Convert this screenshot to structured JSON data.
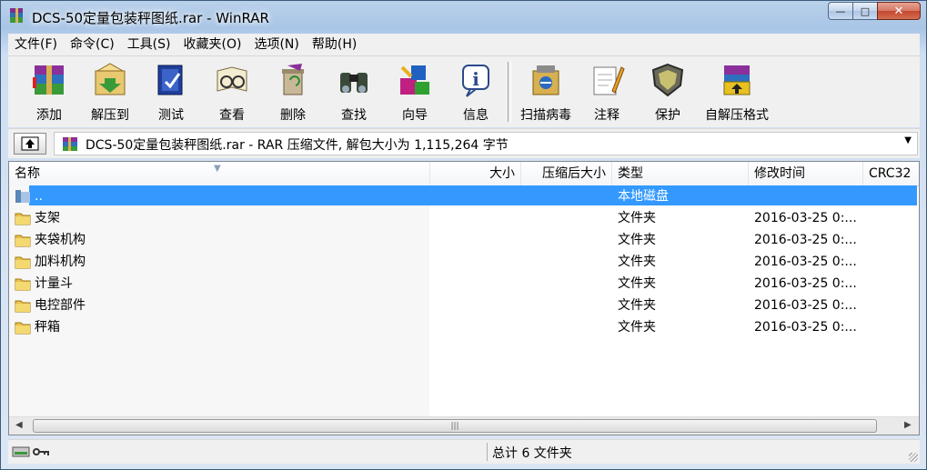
{
  "window": {
    "title": "DCS-50定量包装秤图纸.rar - WinRAR",
    "buttons": {
      "minimize": "—",
      "maximize": "□",
      "close": "✕"
    }
  },
  "menu": [
    "文件(F)",
    "命令(C)",
    "工具(S)",
    "收藏夹(O)",
    "选项(N)",
    "帮助(H)"
  ],
  "toolbar": {
    "items": [
      {
        "label": "添加",
        "icon": "add-archive-icon"
      },
      {
        "label": "解压到",
        "icon": "extract-to-icon"
      },
      {
        "label": "测试",
        "icon": "test-icon"
      },
      {
        "label": "查看",
        "icon": "view-icon"
      },
      {
        "label": "删除",
        "icon": "delete-icon"
      },
      {
        "label": "查找",
        "icon": "find-icon"
      },
      {
        "label": "向导",
        "icon": "wizard-icon"
      },
      {
        "label": "信息",
        "icon": "info-icon"
      },
      {
        "label": "扫描病毒",
        "icon": "virus-scan-icon"
      },
      {
        "label": "注释",
        "icon": "comment-icon"
      },
      {
        "label": "保护",
        "icon": "protect-icon"
      },
      {
        "label": "自解压格式",
        "icon": "sfx-icon"
      }
    ]
  },
  "address": {
    "text": "DCS-50定量包装秤图纸.rar - RAR 压缩文件, 解包大小为 1,115,264 字节"
  },
  "columns": {
    "name": "名称",
    "size": "大小",
    "packed": "压缩后大小",
    "type": "类型",
    "modified": "修改时间",
    "crc": "CRC32"
  },
  "rows": [
    {
      "name": "..",
      "type": "本地磁盘",
      "modified": "",
      "selected": true
    },
    {
      "name": "支架",
      "type": "文件夹",
      "modified": "2016-03-25 0:..."
    },
    {
      "name": "夹袋机构",
      "type": "文件夹",
      "modified": "2016-03-25 0:..."
    },
    {
      "name": "加料机构",
      "type": "文件夹",
      "modified": "2016-03-25 0:..."
    },
    {
      "name": "计量斗",
      "type": "文件夹",
      "modified": "2016-03-25 0:..."
    },
    {
      "name": "电控部件",
      "type": "文件夹",
      "modified": "2016-03-25 0:..."
    },
    {
      "name": "秤箱",
      "type": "文件夹",
      "modified": "2016-03-25 0:..."
    }
  ],
  "status": {
    "text": "总计 6 文件夹"
  },
  "colors": {
    "selection": "#3399ff",
    "titlebar": "#b9d1ea"
  }
}
